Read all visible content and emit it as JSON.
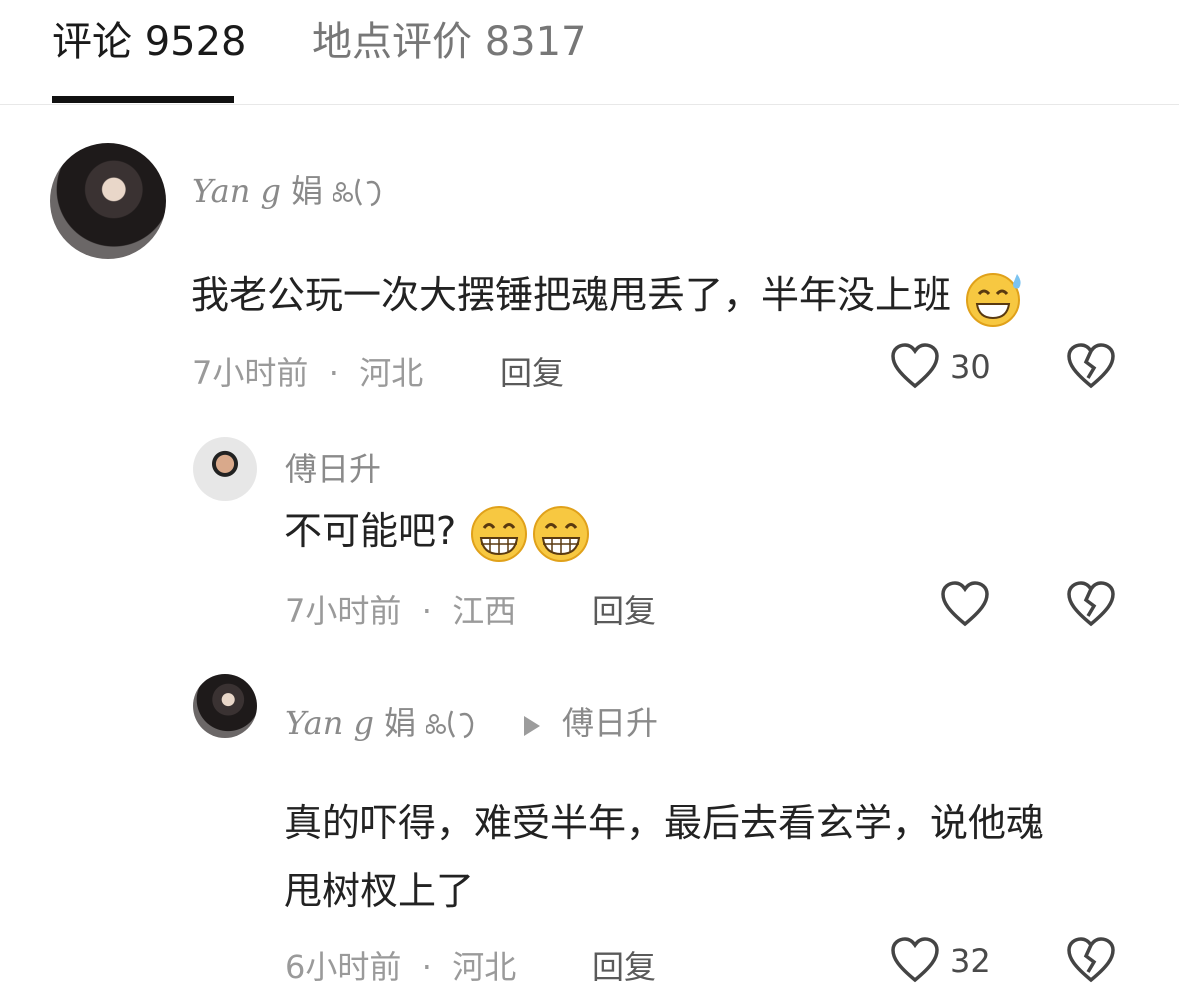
{
  "tabs": [
    {
      "label": "评论 9528",
      "active": true
    },
    {
      "label": "地点评价 8317",
      "active": false
    }
  ],
  "comment1": {
    "user": {
      "script": "Yan g",
      "name": "娟"
    },
    "text": "我老公玩一次大摆锤把魂甩丢了，半年没上班",
    "emoji": "sweat-grin-emoji",
    "time": "7小时前",
    "sep": "·",
    "location": "河北",
    "reply_label": "回复",
    "likes": "30"
  },
  "reply1": {
    "user": {
      "name": "傅日升"
    },
    "text": "不可能吧?",
    "emoji": "grin-emoji",
    "time": "7小时前",
    "sep": "·",
    "location": "江西",
    "reply_label": "回复"
  },
  "reply2": {
    "user": {
      "script": "Yan g",
      "name": "娟"
    },
    "reply_to": "傅日升",
    "text_line1": "真的吓得，难受半年，最后去看玄学，说他魂",
    "text_line2": "甩树杈上了",
    "time": "6小时前",
    "sep": "·",
    "location": "河北",
    "reply_label": "回复",
    "likes": "32"
  }
}
